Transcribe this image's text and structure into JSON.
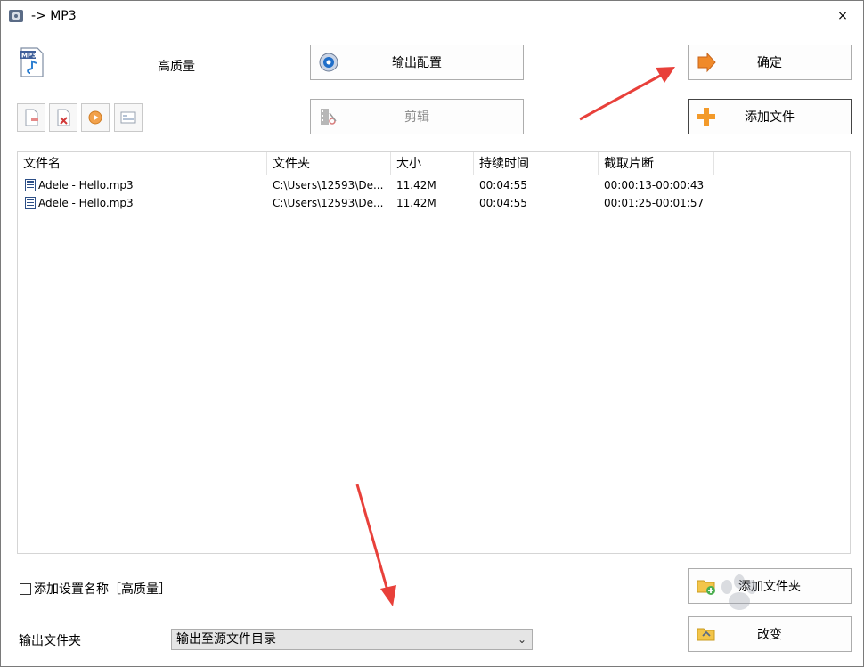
{
  "window": {
    "title": "-> MP3",
    "close_glyph": "×"
  },
  "preset": {
    "label": "高质量",
    "icon": "mp3-file-icon"
  },
  "buttons": {
    "output_config": "输出配置",
    "cut": "剪辑",
    "ok": "确定",
    "add_file": "添加文件",
    "add_folder": "添加文件夹",
    "change": "改变"
  },
  "toolbar_small": [
    "remove-icon",
    "clear-icon",
    "play-icon",
    "info-icon"
  ],
  "table": {
    "columns": [
      "文件名",
      "文件夹",
      "大小",
      "持续时间",
      "截取片断"
    ],
    "rows": [
      {
        "name": "Adele - Hello.mp3",
        "folder": "C:\\Users\\12593\\De...",
        "size": "11.42M",
        "duration": "00:04:55",
        "clip": "00:00:13-00:00:43"
      },
      {
        "name": "Adele - Hello.mp3",
        "folder": "C:\\Users\\12593\\De...",
        "size": "11.42M",
        "duration": "00:04:55",
        "clip": "00:01:25-00:01:57"
      }
    ]
  },
  "options": {
    "add_setting_name_label": "添加设置名称［高质量］",
    "add_setting_name_checked": false
  },
  "output": {
    "label": "输出文件夹",
    "selected": "输出至源文件目录"
  },
  "colors": {
    "annotation_arrow": "#e8403a",
    "button_border": "#adadad",
    "select_bg": "#e5e5e5"
  }
}
